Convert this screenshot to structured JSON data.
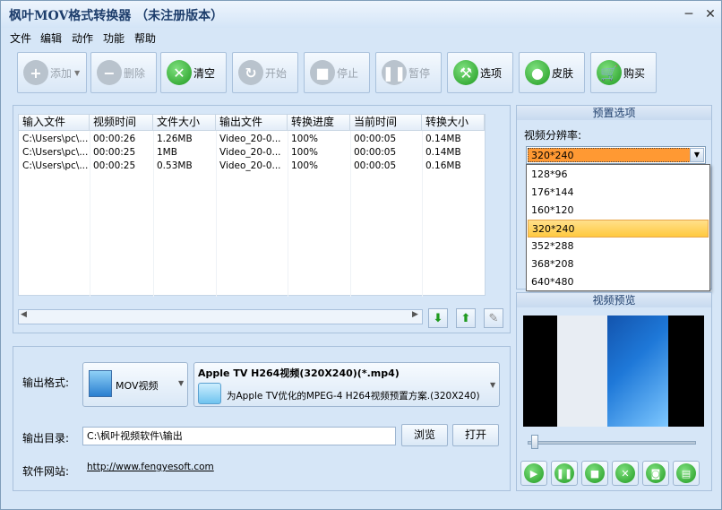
{
  "window": {
    "title": "枫叶MOV格式转换器 （未注册版本）"
  },
  "menu": [
    "文件",
    "编辑",
    "动作",
    "功能",
    "帮助"
  ],
  "toolbar": {
    "add": "添加",
    "delete": "删除",
    "clear": "清空",
    "start": "开始",
    "stop": "停止",
    "pause": "暂停",
    "options": "选项",
    "skin": "皮肤",
    "buy": "购买"
  },
  "table": {
    "headers": [
      "输入文件",
      "视频时间",
      "文件大小",
      "输出文件",
      "转换进度",
      "当前时间",
      "转换大小"
    ],
    "rows": [
      [
        "C:\\Users\\pc\\...",
        "00:00:26",
        "1.26MB",
        "Video_20-0...",
        "100%",
        "00:00:05",
        "0.14MB"
      ],
      [
        "C:\\Users\\pc\\...",
        "00:00:25",
        "1MB",
        "Video_20-0...",
        "100%",
        "00:00:05",
        "0.14MB"
      ],
      [
        "C:\\Users\\pc\\...",
        "00:00:25",
        "0.53MB",
        "Video_20-0...",
        "100%",
        "00:00:05",
        "0.16MB"
      ]
    ]
  },
  "output": {
    "format_label": "输出格式:",
    "format_value": "MOV视频",
    "preset_title": "Apple TV H264视频(320X240)(*.mp4)",
    "preset_desc": "为Apple TV优化的MPEG-4 H264视频预置方案.(320X240)",
    "dir_label": "输出目录:",
    "dir_value": "C:\\枫叶视频软件\\输出",
    "browse": "浏览",
    "open": "打开",
    "site_label": "软件网站:",
    "site_url": "http://www.fengyesoft.com"
  },
  "preset": {
    "header": "预置选项",
    "res_label": "视频分辨率:",
    "res_value": "320*240",
    "options": [
      "128*96",
      "176*144",
      "160*120",
      "320*240",
      "352*288",
      "368*208",
      "640*480"
    ],
    "selected_index": 3
  },
  "preview": {
    "header": "视频预览",
    "progress": 0.02
  },
  "colors": {
    "accent": "#1f9a1f",
    "selection": "#ff9933",
    "panel": "#d6e6f7"
  }
}
